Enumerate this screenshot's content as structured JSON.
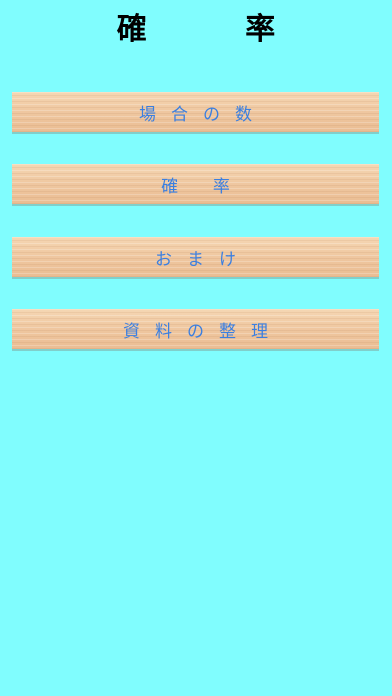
{
  "header": {
    "title": "確 率"
  },
  "menu": {
    "items": [
      {
        "label": "場合の数"
      },
      {
        "label": "確 率"
      },
      {
        "label": "おまけ"
      },
      {
        "label": "資料の整理"
      }
    ]
  }
}
